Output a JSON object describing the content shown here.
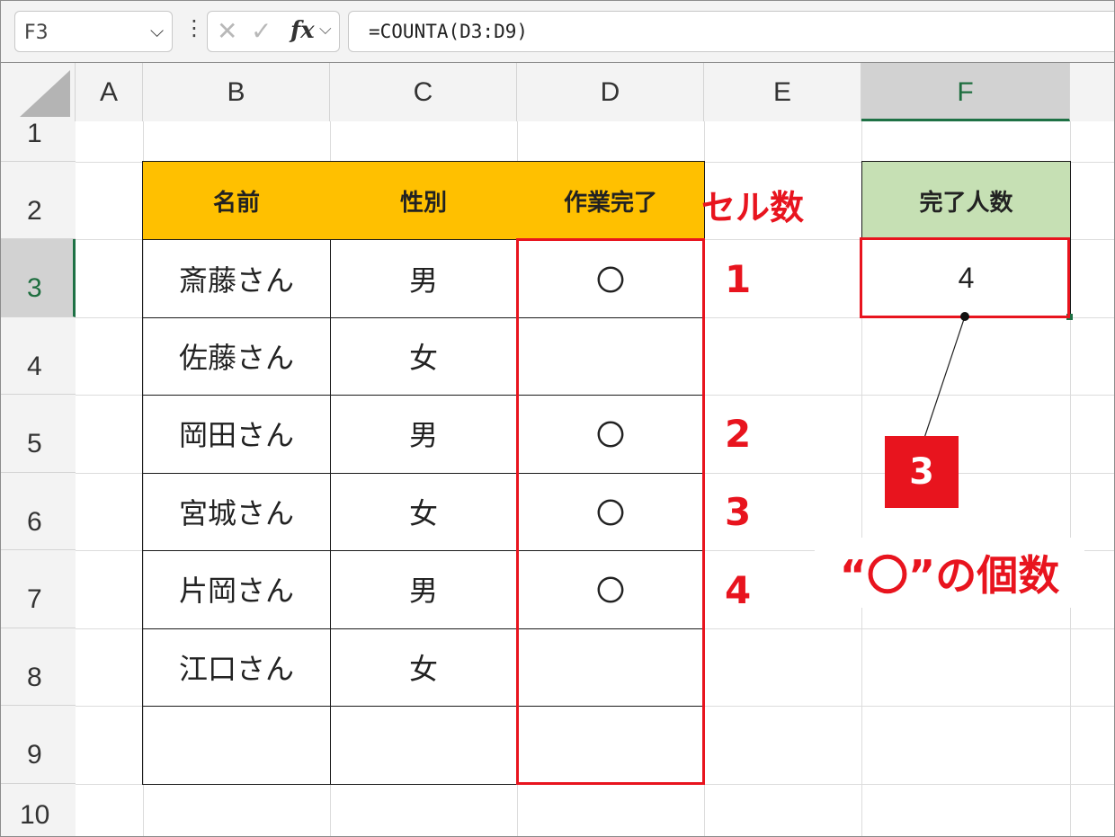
{
  "formula_bar": {
    "name_box": "F3",
    "more": "⋮",
    "cancel": "✕",
    "enter": "✓",
    "fx": "fx",
    "formula": "=COUNTA(D3:D9)"
  },
  "columns": [
    "A",
    "B",
    "C",
    "D",
    "E",
    "F"
  ],
  "rows": [
    "1",
    "2",
    "3",
    "4",
    "5",
    "6",
    "7",
    "8",
    "9",
    "10"
  ],
  "table": {
    "headers": [
      "名前",
      "性別",
      "作業完了"
    ],
    "rows": [
      {
        "name": "斎藤さん",
        "sex": "男",
        "done": "〇"
      },
      {
        "name": "佐藤さん",
        "sex": "女",
        "done": ""
      },
      {
        "name": "岡田さん",
        "sex": "男",
        "done": "〇"
      },
      {
        "name": "宮城さん",
        "sex": "女",
        "done": "〇"
      },
      {
        "name": "片岡さん",
        "sex": "男",
        "done": "〇"
      },
      {
        "name": "江口さん",
        "sex": "女",
        "done": ""
      },
      {
        "name": "",
        "sex": "",
        "done": ""
      }
    ]
  },
  "result": {
    "header": "完了人数",
    "value": "4"
  },
  "annotations": {
    "cell_count_label": "セル数",
    "counts": [
      "1",
      "2",
      "3",
      "4"
    ],
    "badge": "3",
    "caption": "“〇”の個数"
  },
  "colors": {
    "header_orange": "#ffc000",
    "result_green": "#c6e0b4",
    "annotation_red": "#e8141e",
    "selected_header": "#d2d2d2"
  }
}
